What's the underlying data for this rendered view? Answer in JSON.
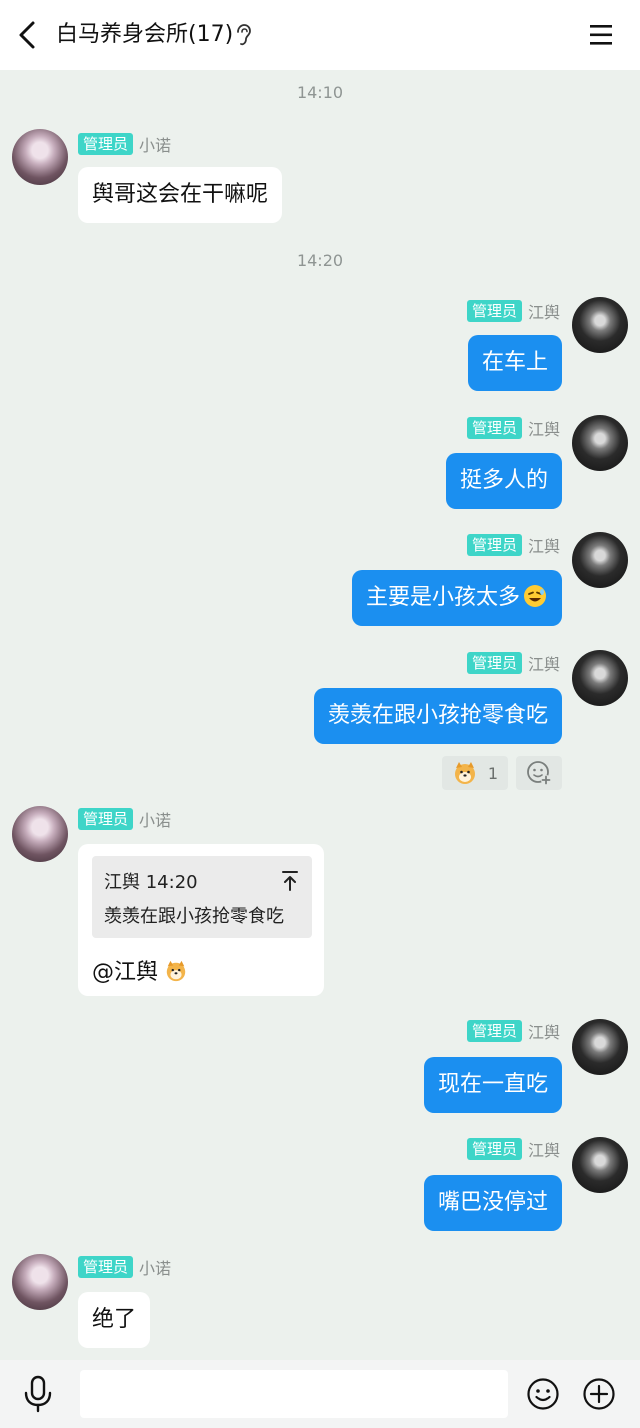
{
  "header": {
    "title": "白马养身会所(17)",
    "icons": {
      "back": "chevron-left-icon",
      "ear": "ear-icon",
      "menu": "menu-icon"
    }
  },
  "times": [
    "14:10",
    "14:20"
  ],
  "role_badge": "管理员",
  "users": {
    "left": "小诺",
    "right": "江舆"
  },
  "messages": [
    {
      "side": "left",
      "text": "舆哥这会在干嘛呢"
    },
    {
      "side": "right",
      "text": "在车上"
    },
    {
      "side": "right",
      "text": "挺多人的"
    },
    {
      "side": "right",
      "text": "主要是小孩太多",
      "emoji": "laughing-face-icon"
    },
    {
      "side": "right",
      "text": "羡羡在跟小孩抢零食吃"
    },
    {
      "side": "left",
      "reply": {
        "quote_header": "江舆 14:20",
        "quote_text": "羡羡在跟小孩抢零食吃",
        "text": "@江舆",
        "emoji": "doge-icon"
      }
    },
    {
      "side": "right",
      "text": "现在一直吃"
    },
    {
      "side": "right",
      "text": "嘴巴没停过"
    },
    {
      "side": "left",
      "text": "绝了"
    }
  ],
  "reaction": {
    "icon": "doge-icon",
    "count": "1",
    "add_icon": "add-reaction-icon"
  },
  "input_bar": {
    "placeholder": "",
    "icons": {
      "mic": "microphone-icon",
      "emoji": "emoji-icon",
      "plus": "plus-icon"
    }
  },
  "colors": {
    "bubble_sent": "#1b8ff0",
    "badge": "#3ed5c8",
    "background": "#ecf1ed"
  }
}
